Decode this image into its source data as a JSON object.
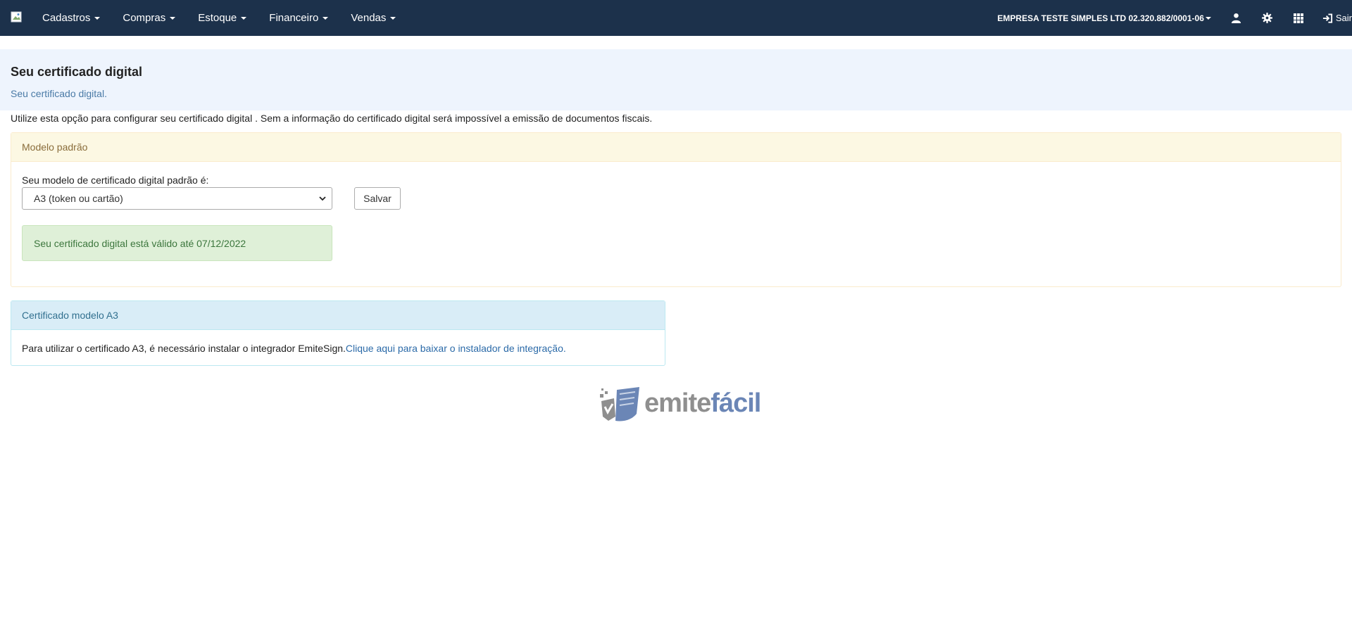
{
  "nav": {
    "menus": [
      "Cadastros",
      "Compras",
      "Estoque",
      "Financeiro",
      "Vendas"
    ],
    "company": "EMPRESA TESTE SIMPLES LTD 02.320.882/0001-06",
    "logout": "Sair",
    "icons": [
      "user-icon",
      "gear-icon",
      "apps-grid-icon",
      "sign-in-icon"
    ]
  },
  "page": {
    "title": "Seu certificado digital",
    "subtitle": "Seu certificado digital.",
    "intro": "Utilize esta opção para configurar seu certificado digital . Sem a informação do certificado digital será impossível a emissão de documentos fiscais."
  },
  "default_panel": {
    "heading": "Modelo padrão",
    "field_label": "Seu modelo de certificado digital padrão é:",
    "selected": "A3 (token ou cartão)",
    "save_label": "Salvar",
    "status": "Seu certificado digital está válido até 07/12/2022"
  },
  "a3_panel": {
    "heading": "Certificado modelo A3",
    "text": "Para utilizar o certificado A3, é necessário instalar o integrador EmiteSign.",
    "link": "Clique aqui para baixar o instalador de integração."
  },
  "logo": {
    "part1": "emite",
    "part2": "fácil",
    "colors": {
      "emite": "#8f8f8f",
      "facil": "#6b86b6"
    }
  },
  "colors": {
    "navbar": "#1c314b",
    "header_band": "#eef4fd",
    "warning_heading": "#fcf8e3",
    "info_heading": "#d9edf7",
    "success": "#dff0d8"
  }
}
